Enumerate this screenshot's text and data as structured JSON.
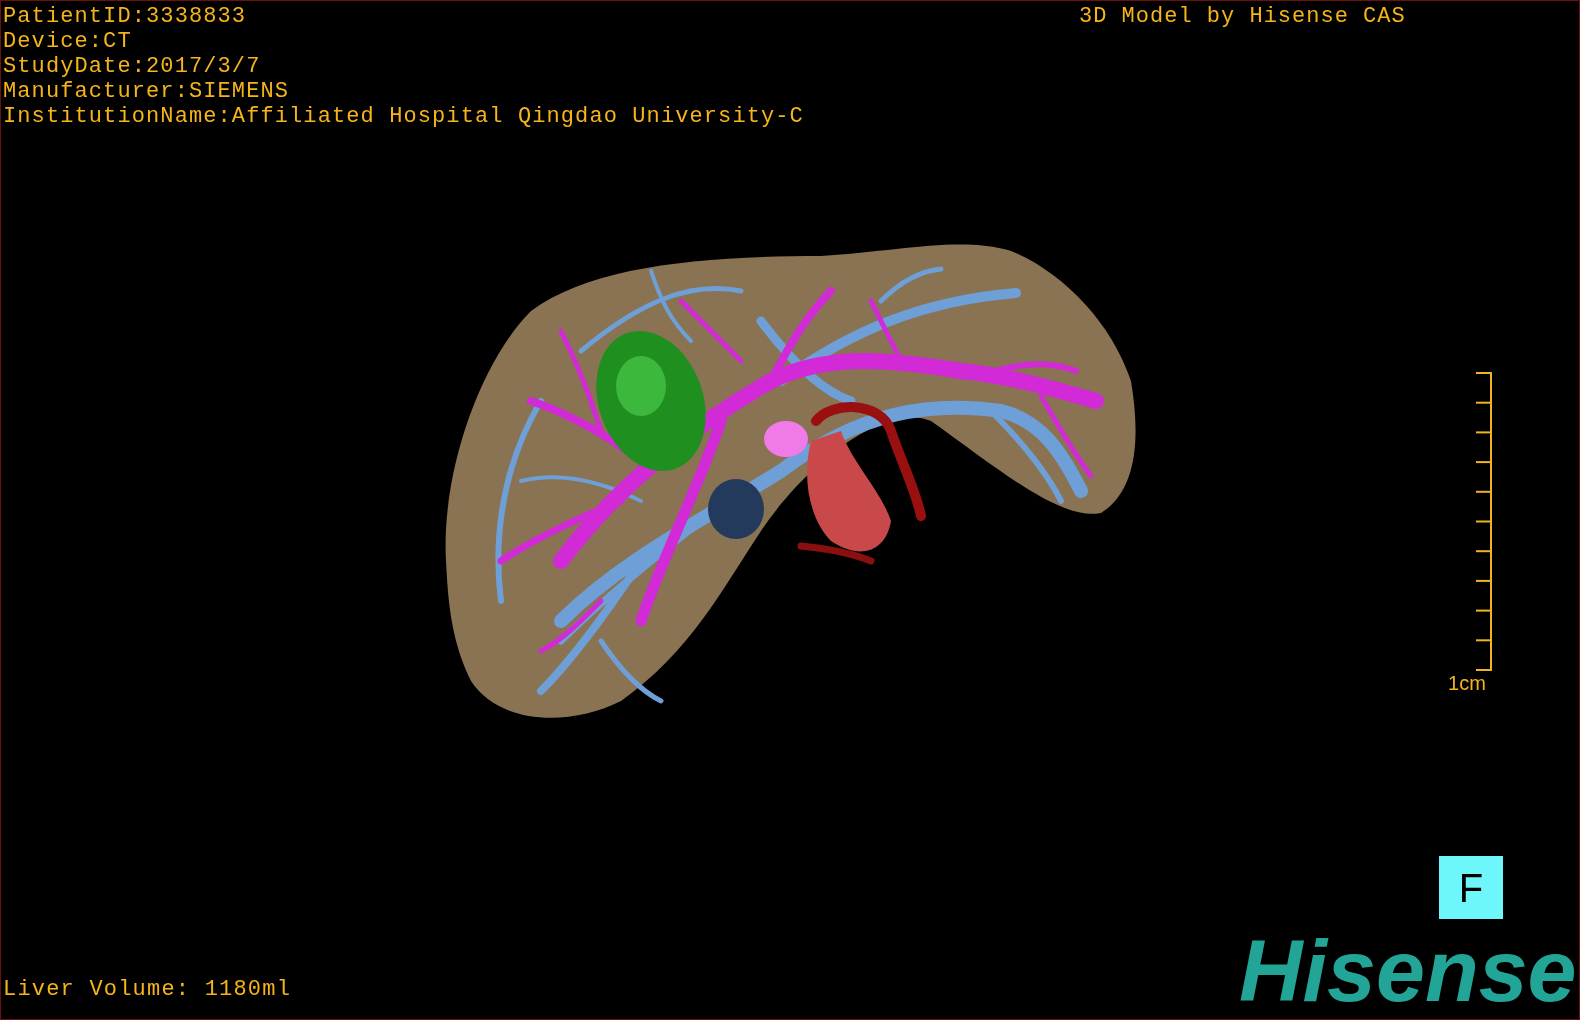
{
  "info_lines": [
    "PatientID:3338833",
    "Device:CT",
    "StudyDate:2017/3/7",
    "Manufacturer:SIEMENS",
    "InstitutionName:Affiliated Hospital Qingdao University-C"
  ],
  "title": "3D Model by Hisense CAS",
  "scale_bar": {
    "label": "1cm"
  },
  "orientation_button": {
    "label": "F"
  },
  "logo": "Hisense",
  "liver_volume": "Liver Volume: 1180ml"
}
